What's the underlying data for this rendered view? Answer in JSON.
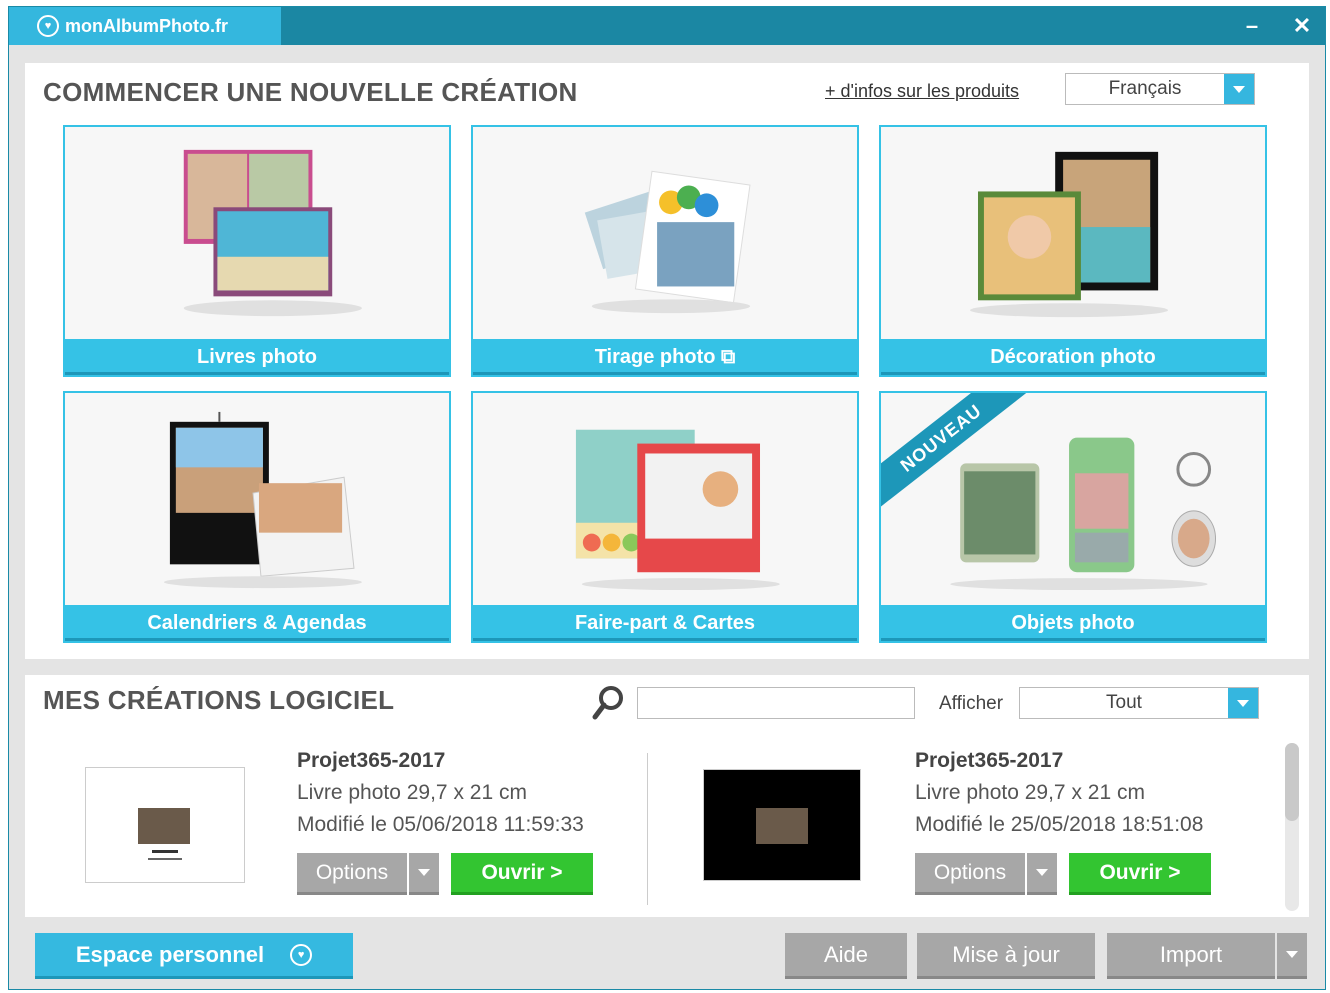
{
  "window": {
    "app_name": "monAlbumPhoto.fr",
    "minimize_icon": "minimize-icon",
    "close_icon": "close-icon"
  },
  "new_creation": {
    "title": "COMMENCER UNE NOUVELLE CRÉATION",
    "info_link": "+ d'infos sur les produits",
    "language": "Français",
    "cards": [
      {
        "label": "Livres photo"
      },
      {
        "label": "Tirage photo"
      },
      {
        "label": "Décoration photo"
      },
      {
        "label": "Calendriers & Agendas"
      },
      {
        "label": "Faire-part & Cartes"
      },
      {
        "label": "Objets photo",
        "badge": "NOUVEAU"
      }
    ]
  },
  "my_creations": {
    "title": "MES CRÉATIONS LOGICIEL",
    "search_value": "",
    "filter_label": "Afficher",
    "filter_value": "Tout",
    "projects": [
      {
        "name": "Projet365-2017",
        "type": "Livre photo 29,7 x 21 cm",
        "modified": "Modifié le 05/06/2018 11:59:33",
        "options_label": "Options",
        "open_label": "Ouvrir >"
      },
      {
        "name": "Projet365-2017",
        "type": "Livre photo 29,7 x 21 cm",
        "modified": "Modifié le 25/05/2018 18:51:08",
        "options_label": "Options",
        "open_label": "Ouvrir >"
      }
    ]
  },
  "footer": {
    "personal_space": "Espace personnel",
    "help": "Aide",
    "update": "Mise à jour",
    "import": "Import"
  },
  "colors": {
    "accent": "#35c2e6",
    "titlebar": "#1b87a3",
    "green": "#33c531",
    "grey_button": "#a7a7a7"
  }
}
